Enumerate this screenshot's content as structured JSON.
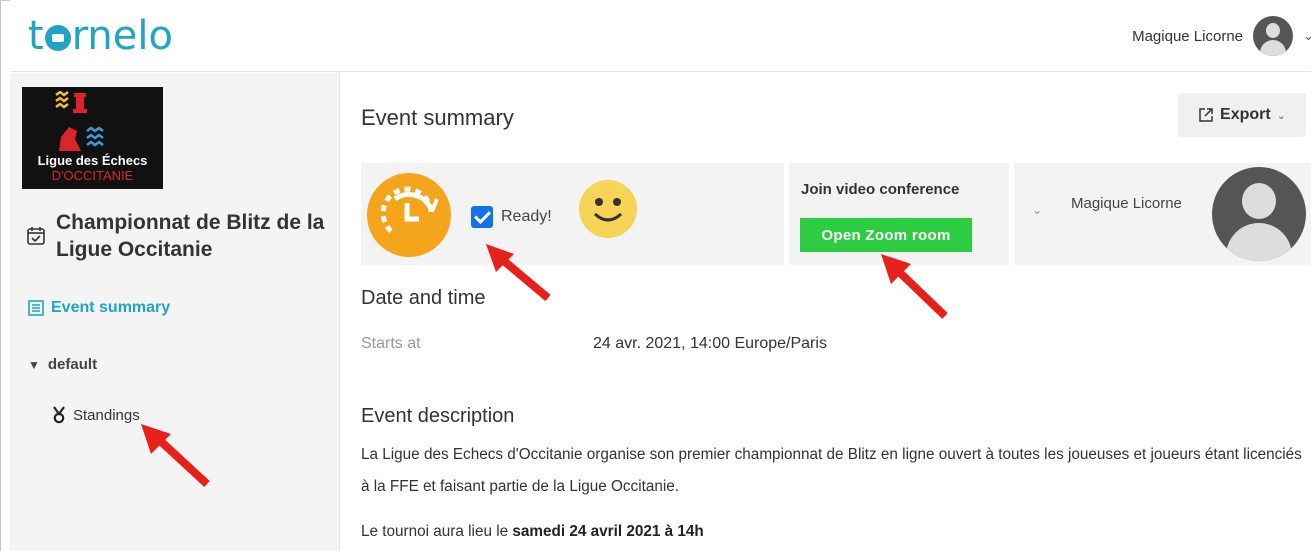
{
  "app": {
    "logo_text": "tornelo",
    "accent": "#1fa4c8"
  },
  "header": {
    "user_name": "Magique Licorne"
  },
  "sidebar": {
    "org_logo_line1": "Ligue des Échecs",
    "org_logo_line2": "D'OCCITANIE",
    "event_title": "Championnat de Blitz de la Ligue Occitanie",
    "nav": {
      "event_summary": "Event summary",
      "section": "default",
      "standings": "Standings"
    }
  },
  "main": {
    "title": "Event summary",
    "export_label": "Export",
    "ready_label": "Ready!",
    "ready_checked": true,
    "video": {
      "title": "Join video conference",
      "button": "Open Zoom room",
      "button_color": "#2ecc40"
    },
    "panel_user_name": "Magique Licorne",
    "date_heading": "Date and time",
    "starts_label": "Starts at",
    "starts_value": "24 avr. 2021, 14:00 Europe/Paris",
    "desc_heading": "Event description",
    "desc_text": "La Ligue des Echecs d'Occitanie organise son premier championnat de Blitz en ligne ouvert à toutes les joueuses et joueurs étant licenciés à la FFE et faisant partie de la Ligue Occitanie.",
    "desc_line2_prefix": "Le tournoi aura lieu le ",
    "desc_line2_bold": "samedi 24 avril 2021 à 14h"
  },
  "annotation_color": "#e8201a"
}
